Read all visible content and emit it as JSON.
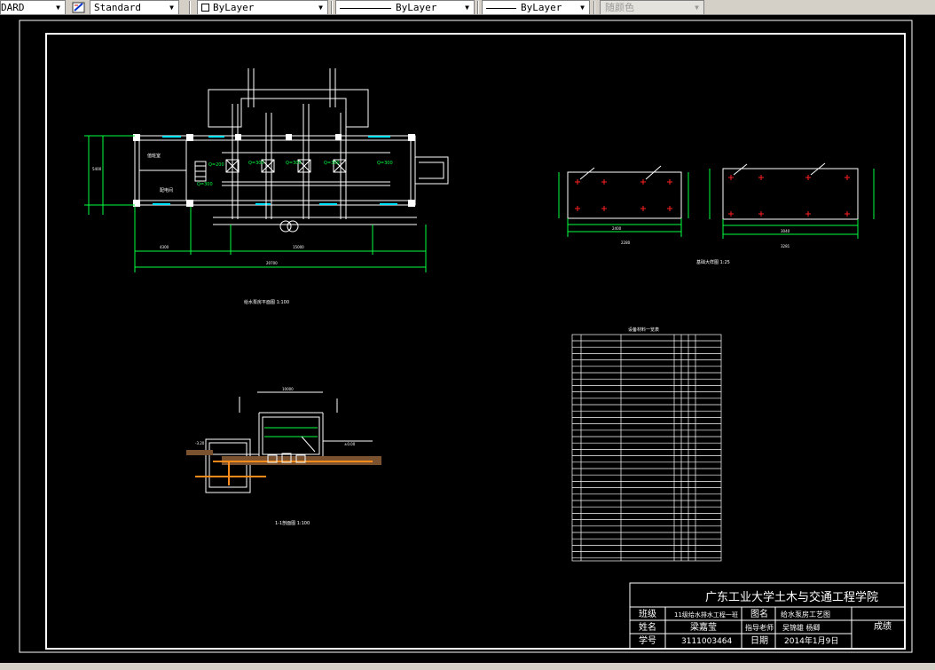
{
  "toolbar": {
    "textstyle_value": "DARD",
    "dimstyle_value": "Standard",
    "layer_color_value": "ByLayer",
    "linetype_value": "ByLayer",
    "lineweight_value": "ByLayer",
    "plotstyle_value": "随颜色"
  },
  "drawing": {
    "plan_caption": "给水泵房平面图 1:100",
    "foundation_caption": "基础大样图 1:25",
    "section_caption": "1-1剖面图 1:100",
    "table_title": "设备材料一览表",
    "title_block": {
      "school": "广东工业大学土木与交通工程学院",
      "class_label": "班级",
      "class_value": "11级给水排水工程一班",
      "name_label": "姓名",
      "name_value": "梁嘉莹",
      "id_label": "学号",
      "id_value": "3111003464",
      "drawing_name_label": "图名",
      "drawing_name_value": "给水泵房工艺图",
      "teacher_label": "指导老师",
      "teacher_value": "吴锦雄 杨卿",
      "date_label": "日期",
      "date_value": "2014年1月9日",
      "score_label": "成绩"
    }
  }
}
